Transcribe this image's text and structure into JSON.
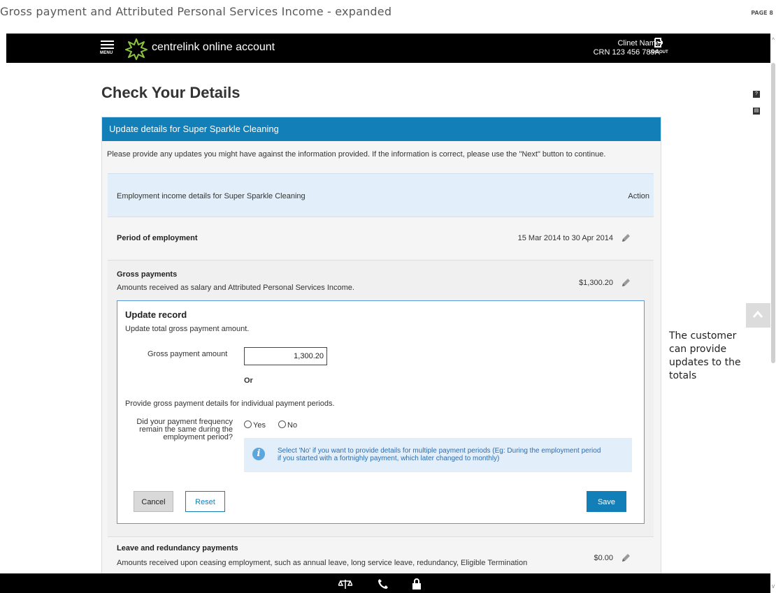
{
  "document": {
    "title": "Gross payment and Attributed Personal Services Income - expanded",
    "page_label": "PAGE 8"
  },
  "topbar": {
    "menu_label": "MENU",
    "brand": "centrelink online account",
    "client_name": "Clinet Name",
    "crn": "CRN 123 456 789A",
    "logout_label": "LOG OUT"
  },
  "page": {
    "heading": "Check Your Details"
  },
  "panel": {
    "header": "Update details for Super Sparkle Cleaning",
    "intro": "Please provide any updates you might have against the information provided. If the information is correct, please use the \"Next\" button to continue.",
    "section_title": "Employment income details for Super Sparkle Cleaning",
    "action_label": "Action",
    "period": {
      "label": "Period of employment",
      "value": "15 Mar 2014 to 30 Apr 2014"
    },
    "gross": {
      "label": "Gross payments",
      "sub": "Amounts received as salary and Attributed Personal Services Income.",
      "value": "$1,300.20"
    },
    "update_record": {
      "title": "Update record",
      "subtitle": "Update total gross payment amount.",
      "amount_label": "Gross payment amount",
      "amount_value": "1,300.20",
      "or_label": "Or",
      "provide_text": "Provide gross payment details for individual payment periods.",
      "frequency_question_line1": "Did your payment frequency",
      "frequency_question_line2": "remain the same during the",
      "frequency_question_line3": "employment period?",
      "yes_label": "Yes",
      "no_label": "No",
      "info_line1": "Select 'No' if you want to provide details for multiple payment periods (Eg: During the employment period",
      "info_line2": "if you started with a fortnighly payment, which later changed to monthly)",
      "cancel_label": "Cancel",
      "reset_label": "Reset",
      "save_label": "Save"
    },
    "leave": {
      "label": "Leave and redundancy payments",
      "sub": "Amounts received upon ceasing employment, such as annual leave, long service leave, redundancy, Eligible Termination",
      "value": "$0.00"
    }
  },
  "annotation": {
    "text_line1": "The customer",
    "text_line2": "can provide",
    "text_line3": "updates to the",
    "text_line4": "totals"
  },
  "side_tools": {
    "help_glyph": "?",
    "print_glyph": "▤"
  },
  "colors": {
    "brand_blue": "#137fb8",
    "light_blue": "#e2effa",
    "info_text": "#2b6cb0",
    "topbar": "#000000"
  },
  "icons": [
    "menu-icon",
    "centrelink-star-logo",
    "logout-icon",
    "pencil-icon",
    "info-icon",
    "scroll-to-top-icon",
    "scales-icon",
    "phone-icon",
    "lock-icon",
    "help-icon",
    "print-icon"
  ]
}
